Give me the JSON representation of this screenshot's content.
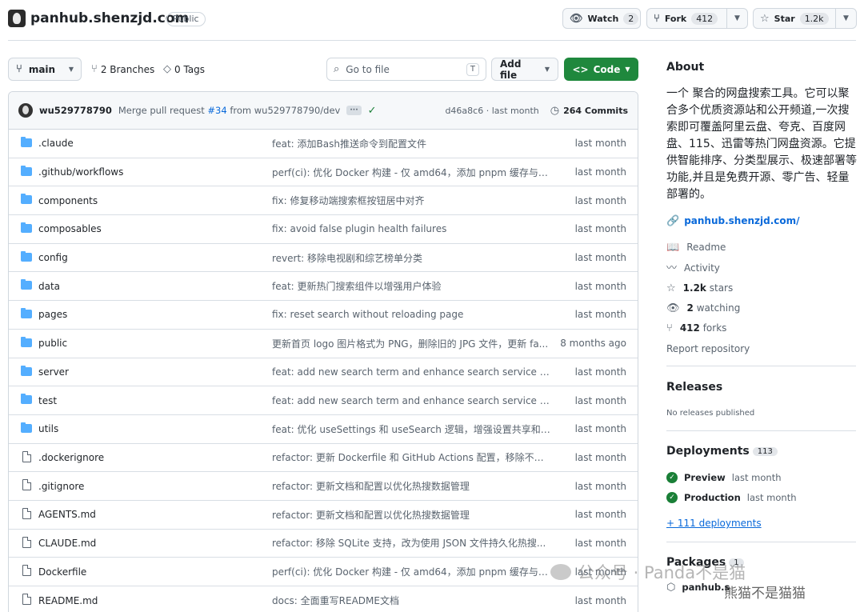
{
  "repo": {
    "name": "panhub.shenzjd.com",
    "visibility": "Public"
  },
  "header_buttons": {
    "watch": {
      "label": "Watch",
      "count": "2"
    },
    "fork": {
      "label": "Fork",
      "count": "412"
    },
    "star": {
      "label": "Star",
      "count": "1.2k"
    }
  },
  "toolbar": {
    "branch": "main",
    "branches": "2 Branches",
    "tags": "0 Tags",
    "goto_placeholder": "Go to file",
    "goto_kbd": "T",
    "add_file": "Add file",
    "code": "Code"
  },
  "commit": {
    "author": "wu529778790",
    "msg_prefix": "Merge pull request",
    "pr": "#34",
    "msg_suffix": "from wu529778790/dev",
    "hash_time": "d46a8c6 · last month",
    "commits": "264 Commits"
  },
  "files": [
    {
      "type": "dir",
      "name": ".claude",
      "msg": "feat: 添加Bash推送命令到配置文件",
      "date": "last month"
    },
    {
      "type": "dir",
      "name": ".github/workflows",
      "msg": "perf(ci): 优化 Docker 构建 - 仅 amd64，添加 pnpm 缓存与超时",
      "date": "last month"
    },
    {
      "type": "dir",
      "name": "components",
      "msg": "fix: 修复移动端搜索框按钮居中对齐",
      "date": "last month"
    },
    {
      "type": "dir",
      "name": "composables",
      "msg": "fix: avoid false plugin health failures",
      "date": "last month"
    },
    {
      "type": "dir",
      "name": "config",
      "msg": "revert: 移除电视剧和综艺榜单分类",
      "date": "last month"
    },
    {
      "type": "dir",
      "name": "data",
      "msg": "feat: 更新热门搜索组件以增强用户体验",
      "date": "last month"
    },
    {
      "type": "dir",
      "name": "pages",
      "msg": "fix: reset search without reloading page",
      "date": "last month"
    },
    {
      "type": "dir",
      "name": "public",
      "msg": "更新首页 logo 图片格式为 PNG，删除旧的 JPG 文件，更新 fa...",
      "date": "8 months ago"
    },
    {
      "type": "dir",
      "name": "server",
      "msg": "feat: add new search term and enhance search service functio...",
      "date": "last month"
    },
    {
      "type": "dir",
      "name": "test",
      "msg": "feat: add new search term and enhance search service functio...",
      "date": "last month"
    },
    {
      "type": "dir",
      "name": "utils",
      "msg": "feat: 优化 useSettings 和 useSearch 逻辑，增强设置共享和搜...",
      "date": "last month"
    },
    {
      "type": "file",
      "name": ".dockerignore",
      "msg": "refactor: 更新 Dockerfile 和 GitHub Actions 配置，移除不必...",
      "date": "last month"
    },
    {
      "type": "file",
      "name": ".gitignore",
      "msg": "refactor: 更新文档和配置以优化热搜数据管理",
      "date": "last month"
    },
    {
      "type": "file",
      "name": "AGENTS.md",
      "msg": "refactor: 更新文档和配置以优化热搜数据管理",
      "date": "last month"
    },
    {
      "type": "file",
      "name": "CLAUDE.md",
      "msg": "refactor: 移除 SQLite 支持，改为使用 JSON 文件持久化热搜...",
      "date": "last month"
    },
    {
      "type": "file",
      "name": "Dockerfile",
      "msg": "perf(ci): 优化 Docker 构建 - 仅 amd64，添加 pnpm 缓存与超时",
      "date": "last month"
    },
    {
      "type": "file",
      "name": "README.md",
      "msg": "docs: 全面重写README文档",
      "date": "last month"
    }
  ],
  "about": {
    "heading": "About",
    "description": "一个 聚合的网盘搜索工具。它可以聚合多个优质资源站和公开频道,一次搜索即可覆盖阿里云盘、夸克、百度网盘、115、迅雷等热门网盘资源。它提供智能排序、分类型展示、极速部署等功能,并且是免费开源、零广告、轻量部署的。",
    "link": "panhub.shenzjd.com/",
    "readme": "Readme",
    "activity": "Activity",
    "stars_num": "1.2k",
    "stars_label": "stars",
    "watching_num": "2",
    "watching_label": "watching",
    "forks_num": "412",
    "forks_label": "forks",
    "report": "Report repository"
  },
  "releases": {
    "heading": "Releases",
    "empty": "No releases published"
  },
  "deployments": {
    "heading": "Deployments",
    "count": "113",
    "items": [
      {
        "name": "Preview",
        "time": "last month"
      },
      {
        "name": "Production",
        "time": "last month"
      }
    ],
    "more": "+ 111 deployments"
  },
  "packages": {
    "heading": "Packages",
    "count": "1",
    "item": "panhub.s"
  },
  "watermark": {
    "line1": "公众号 · Panda不是猫",
    "line2": "熊猫不是猫猫"
  }
}
